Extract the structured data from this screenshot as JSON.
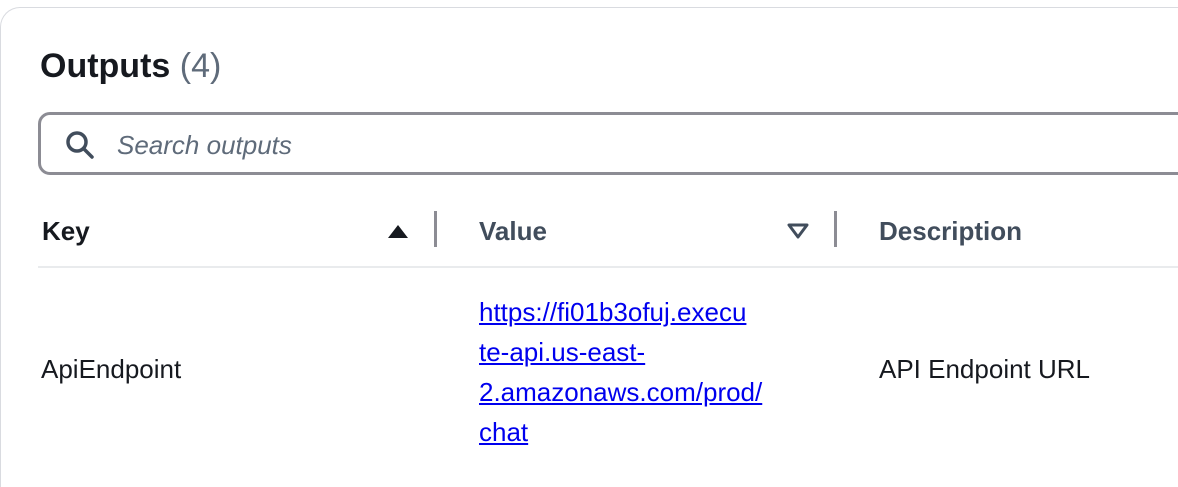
{
  "header": {
    "title": "Outputs",
    "count": "(4)"
  },
  "search": {
    "placeholder": "Search outputs",
    "value": ""
  },
  "table": {
    "columns": [
      {
        "label": "Key",
        "sort": "ascending"
      },
      {
        "label": "Value",
        "sort": "descending"
      },
      {
        "label": "Description"
      }
    ],
    "rows": [
      {
        "key": "ApiEndpoint",
        "value_lines": [
          "https://fi01b3ofuj.execu",
          "te-api.us-east-",
          "2.amazonaws.com/prod/",
          "chat"
        ],
        "value_url": "https://fi01b3ofuj.execute-api.us-east-2.amazonaws.com/prod/chat",
        "description": "API Endpoint URL"
      }
    ]
  },
  "colors": {
    "link": "#0000ee",
    "text": "#16191f",
    "muted": "#5f6b7a"
  },
  "icons": {
    "search": "search-icon",
    "sort_asc": "caret-up-filled-icon",
    "sort_desc": "caret-down-outline-icon"
  }
}
